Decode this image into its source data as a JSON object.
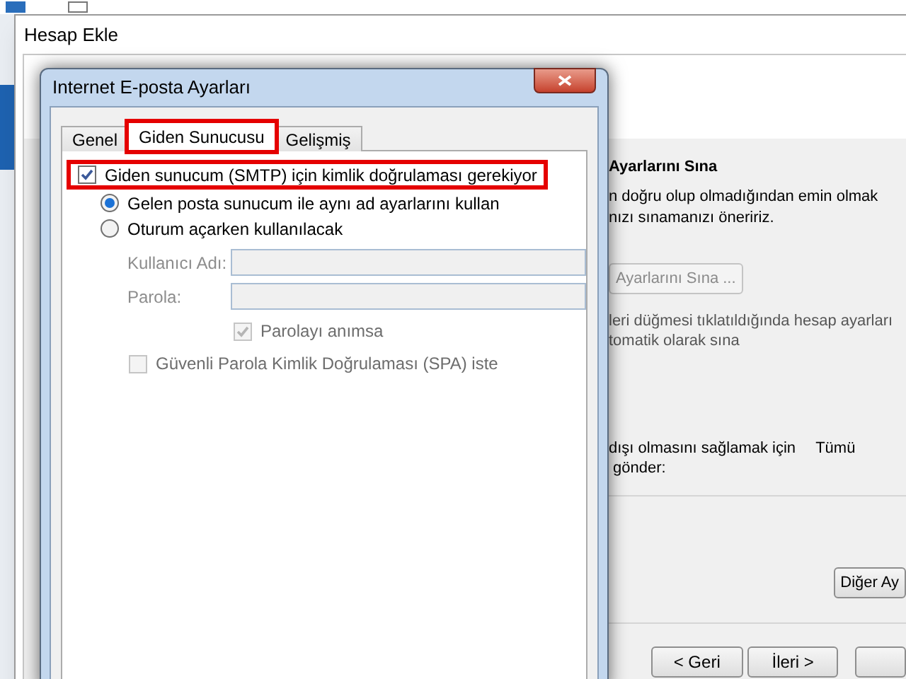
{
  "window": {
    "title": "Hesap Ekle"
  },
  "right_panel": {
    "heading": "Ayarlarını Sına",
    "intro_lines": [
      "n doğru olup olmadığından emin olmak",
      "nızı sınamanızı öneririz."
    ],
    "test_button": {
      "label": "Ayarlarını Sına ...",
      "disabled": true
    },
    "auto_test_lines": [
      "leri düğmesi tıklatıldığında hesap ayarları",
      "tomatik olarak sına"
    ],
    "send_text": "dışı olmasını sağlamak için",
    "send_option": "Tümü",
    "send_text_2": "gönder:",
    "more_button": "Diğer Ay"
  },
  "wizard_buttons": [
    {
      "label": "< Geri"
    },
    {
      "label": "İleri >"
    }
  ],
  "dialog": {
    "title": "Internet E-posta Ayarları",
    "tabs": [
      {
        "label": "Genel",
        "selected": false,
        "highlighted": false
      },
      {
        "label": "Giden Sunucusu",
        "selected": true,
        "highlighted": true
      },
      {
        "label": "Gelişmiş",
        "selected": false,
        "highlighted": false
      }
    ],
    "auth_checkbox": {
      "label": "Giden sunucum (SMTP) için kimlik doğrulaması gerekiyor",
      "checked": true,
      "highlighted": true
    },
    "auth_options": [
      {
        "label": "Gelen posta sunucum ile aynı ad ayarlarını kullan",
        "selected": true
      },
      {
        "label": "Oturum açarken kullanılacak",
        "selected": false
      }
    ],
    "fields": [
      {
        "label": "Kullanıcı Adı:",
        "disabled": true
      },
      {
        "label": "Parola:",
        "disabled": true
      }
    ],
    "remember_password": {
      "label": "Parolayı anımsa",
      "checked": true,
      "disabled": true
    },
    "spa_checkbox": {
      "label": "Güvenli Parola Kimlik Doğrulaması (SPA) iste",
      "checked": false,
      "disabled": true
    }
  }
}
